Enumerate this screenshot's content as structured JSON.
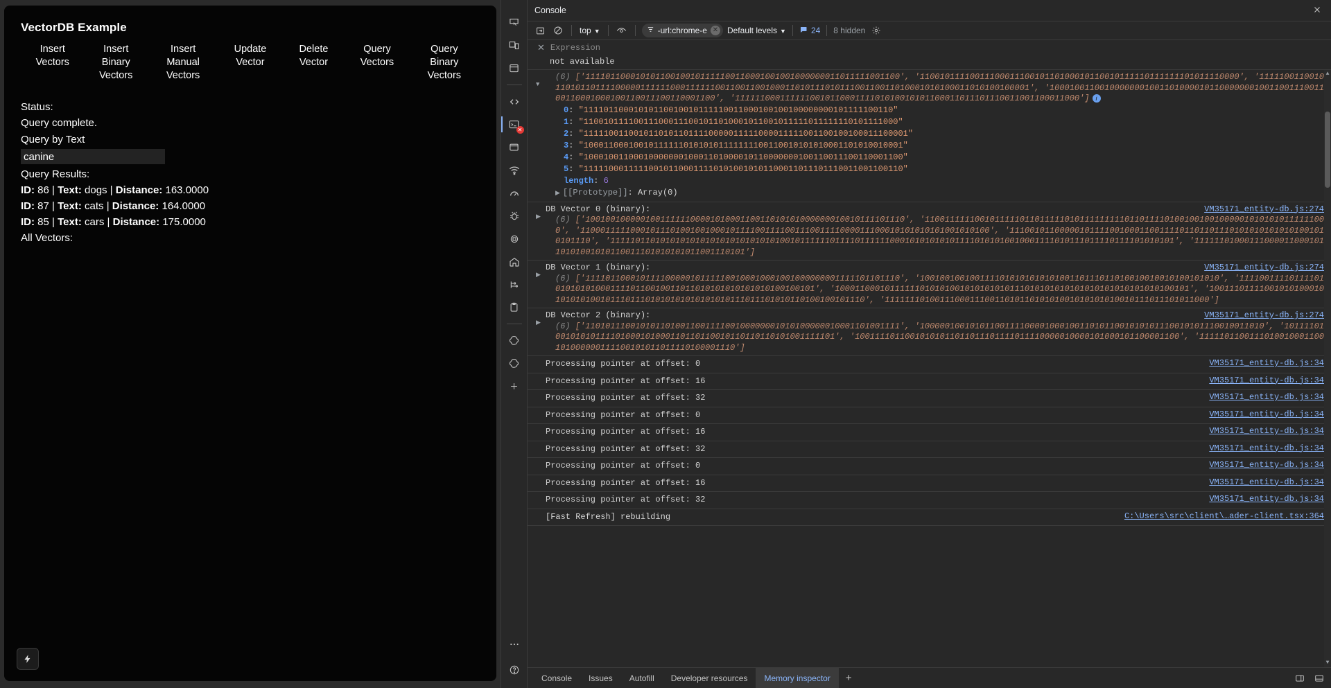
{
  "page": {
    "title": "VectorDB Example",
    "buttons": [
      {
        "label": "Insert Vectors",
        "name": "insert-vectors-button"
      },
      {
        "label": "Insert Binary Vectors",
        "name": "insert-binary-vectors-button"
      },
      {
        "label": "Insert Manual Vectors",
        "name": "insert-manual-vectors-button"
      },
      {
        "label": "Update Vector",
        "name": "update-vector-button"
      },
      {
        "label": "Delete Vector",
        "name": "delete-vector-button"
      },
      {
        "label": "Query Vectors",
        "name": "query-vectors-button"
      },
      {
        "label": "Query Binary Vectors",
        "name": "query-binary-vectors-button"
      }
    ],
    "status_label": "Status:",
    "status_value": "Query complete.",
    "query_by_text_label": "Query by Text",
    "query_input_value": "canine",
    "query_input_placeholder": "",
    "query_results_label": "Query Results:",
    "results": [
      {
        "id_label": "ID:",
        "id": "86",
        "text_label": "Text:",
        "text": "dogs",
        "distance_label": "Distance:",
        "distance": "163.0000"
      },
      {
        "id_label": "ID:",
        "id": "87",
        "text_label": "Text:",
        "text": "cats",
        "distance_label": "Distance:",
        "distance": "164.0000"
      },
      {
        "id_label": "ID:",
        "id": "85",
        "text_label": "Text:",
        "text": "cars",
        "distance_label": "Distance:",
        "distance": "175.0000"
      }
    ],
    "all_vectors_label": "All Vectors:",
    "fab_icon": "lightning-icon"
  },
  "devtools": {
    "panel_title": "Console",
    "close_icon": "close-icon",
    "toolbar": {
      "clear_console_icon": "clear-console-icon",
      "no_entry_icon": "no-entry-icon",
      "context": "top",
      "eye_icon": "live-expression-eye-icon",
      "filter_icon": "filter-icon",
      "filter_text": "-url:chrome-e",
      "filter_clear_icon": "filter-clear-icon",
      "levels": "Default levels",
      "message_count": "24",
      "message_icon": "speech-bubble-icon",
      "hidden_text": "8 hidden",
      "settings_icon": "gear-icon"
    },
    "expression": {
      "close_icon": "close-icon",
      "placeholder": "Expression",
      "eager_result": "not available"
    },
    "rail_icons": [
      {
        "name": "inspect-element-icon"
      },
      {
        "name": "device-toolbar-icon"
      },
      {
        "name": "elements-panel-icon"
      },
      {
        "name": "sources-panel-icon"
      },
      {
        "name": "console-panel-icon"
      },
      {
        "name": "application-panel-icon"
      },
      {
        "name": "network-panel-icon"
      },
      {
        "name": "performance-panel-icon"
      },
      {
        "name": "memory-panel-icon"
      },
      {
        "name": "lighthouse-panel-icon"
      },
      {
        "name": "recorder-home-icon"
      },
      {
        "name": "animations-icon"
      },
      {
        "name": "clipboard-icon"
      },
      {
        "name": "react-components-icon"
      },
      {
        "name": "react-profiler-icon"
      },
      {
        "name": "add-panel-icon"
      },
      {
        "name": "more-tools-icon"
      },
      {
        "name": "help-icon"
      }
    ],
    "messages": [
      {
        "kind": "array-expanded",
        "twisty": "down",
        "count": "(6)",
        "preview": "['111101100010101100100101111100110001001001000000011011111001100', '1100101111001110001110010110100010110010111110111111101011110000', '111110011001011010110111100000111111000111111001100110010001101011101011100110011010001010100011010100100001', '100010011001000000010011010000101100000001001100111001100110001000100110011100110001100', '111111000111111001011000111101010010101100011011101110011001100011000']",
        "source": "",
        "indices": [
          {
            "key": "0",
            "value": "\"11110110001010110010010111110011000100100100000000101111100110\""
          },
          {
            "key": "1",
            "value": "\"110010111100111000111001011010001011001011111011111110101111000\""
          },
          {
            "key": "2",
            "value": "\"11111001100101101011011110000011111000011111001100100100011100001\""
          },
          {
            "key": "3",
            "value": "\"1000110001001011111101010101111111100110010101010001101010010001\""
          },
          {
            "key": "4",
            "value": "\"1000100110001000000010001101000010110000000100110011100110001100\""
          },
          {
            "key": "5",
            "value": "\"1111100011111001011000111101010010101100011011101110011001100110\""
          }
        ],
        "length_key": "length",
        "length_value": "6",
        "prototype_label": "[[Prototype]]",
        "prototype_value": "Array(0)",
        "info_badge": "i"
      },
      {
        "kind": "vector",
        "header": "DB Vector 0 (binary):",
        "count": "(6)",
        "preview": "['1001001000001001111110000101000110011010101000000010010111101110', '110011111100101111101101111101011111111101101111010010010010000010101010111111000', '1100011111000101110100100100010111100111100111001111000011100010101010101001010100', '1110010110000010111100100011001111011011011101010101010101001010101110', '11111011010101010101010101010101010010111111011110111111000101010101011110101010010001111010111011110111101010101', '1111110100011100001100010110101001010110011101010101011001110101']",
        "source": "VM35171_entity-db.js:274"
      },
      {
        "kind": "vector",
        "header": "DB Vector 1 (binary):",
        "count": "(6)",
        "preview": "['111101100010111100000101111100100010001001000000001111101101110', '100100100100111101010101010100110111011010010010010100101010', '111100111101111010101010100011110110010011011010101010101010100100101', '10001100010111111010101001010101010111010101010101010101010101010100101', '1001110111100101010001010101010010111011101010101010101010111011101010110100100101110', '11111110100111000111001101011010101001010101010010111011101011000']",
        "source": "VM35171_entity-db.js:274"
      },
      {
        "kind": "vector",
        "header": "DB Vector 2 (binary):",
        "count": "(6)",
        "preview": "['110101110010101101001100111100100000001010100000010001101001111', '100000100101011001111000010001001101011001010101110010101110010011010', '1011110100101010111101000101000110110110010110110110101001111101', '10011110110010101011011011101111011110000010000101000101100001100', '1111101100111010010001100101000000111100101011011110100001110']",
        "source": "VM35171_entity-db.js:274"
      },
      {
        "kind": "simple",
        "text": "Processing pointer at offset: 0",
        "source": "VM35171_entity-db.js:34"
      },
      {
        "kind": "simple",
        "text": "Processing pointer at offset: 16",
        "source": "VM35171_entity-db.js:34"
      },
      {
        "kind": "simple",
        "text": "Processing pointer at offset: 32",
        "source": "VM35171_entity-db.js:34"
      },
      {
        "kind": "simple",
        "text": "Processing pointer at offset: 0",
        "source": "VM35171_entity-db.js:34"
      },
      {
        "kind": "simple",
        "text": "Processing pointer at offset: 16",
        "source": "VM35171_entity-db.js:34"
      },
      {
        "kind": "simple",
        "text": "Processing pointer at offset: 32",
        "source": "VM35171_entity-db.js:34"
      },
      {
        "kind": "simple",
        "text": "Processing pointer at offset: 0",
        "source": "VM35171_entity-db.js:34"
      },
      {
        "kind": "simple",
        "text": "Processing pointer at offset: 16",
        "source": "VM35171_entity-db.js:34"
      },
      {
        "kind": "simple",
        "text": "Processing pointer at offset: 32",
        "source": "VM35171_entity-db.js:34"
      },
      {
        "kind": "simple",
        "text": "[Fast Refresh] rebuilding",
        "source": "C:\\Users\\src\\client\\…ader-client.tsx:364"
      }
    ],
    "drawer_tabs": [
      {
        "label": "Console",
        "selected": false
      },
      {
        "label": "Issues",
        "selected": false
      },
      {
        "label": "Autofill",
        "selected": false
      },
      {
        "label": "Developer resources",
        "selected": false
      },
      {
        "label": "Memory inspector",
        "selected": true
      }
    ],
    "drawer_add_icon": "add-tab-icon",
    "drawer_right_icons": [
      {
        "name": "dock-side-icon"
      },
      {
        "name": "dock-bottom-icon"
      }
    ]
  },
  "colors": {
    "accent_blue": "#8ab4f8",
    "string_orange": "#e09a72",
    "key_blue": "#5a9cf8",
    "number_purple": "#9a7ae0",
    "panel_bg": "#282828",
    "page_bg": "#050505",
    "error_red": "#e53935"
  }
}
